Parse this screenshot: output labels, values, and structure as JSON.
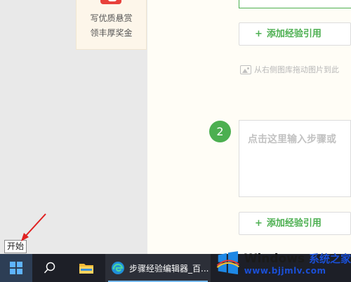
{
  "reward": {
    "line1": "写优质悬赏",
    "line2": "领丰厚奖金"
  },
  "editor": {
    "add_reference_label": "添加经验引用",
    "add_plus": "+",
    "drag_hint": "从右侧图库拖动图片到此",
    "step_number": "2",
    "step_placeholder": "点击这里输入步骤或",
    "accent_color": "#4caf50"
  },
  "tooltip": {
    "text": "开始"
  },
  "taskbar": {
    "edge_tab_label": "步骤经验编辑器_百..."
  },
  "watermark": {
    "brand": "Windows",
    "brand_cn": "系统之家",
    "url": "www.bjjmlv.com"
  }
}
